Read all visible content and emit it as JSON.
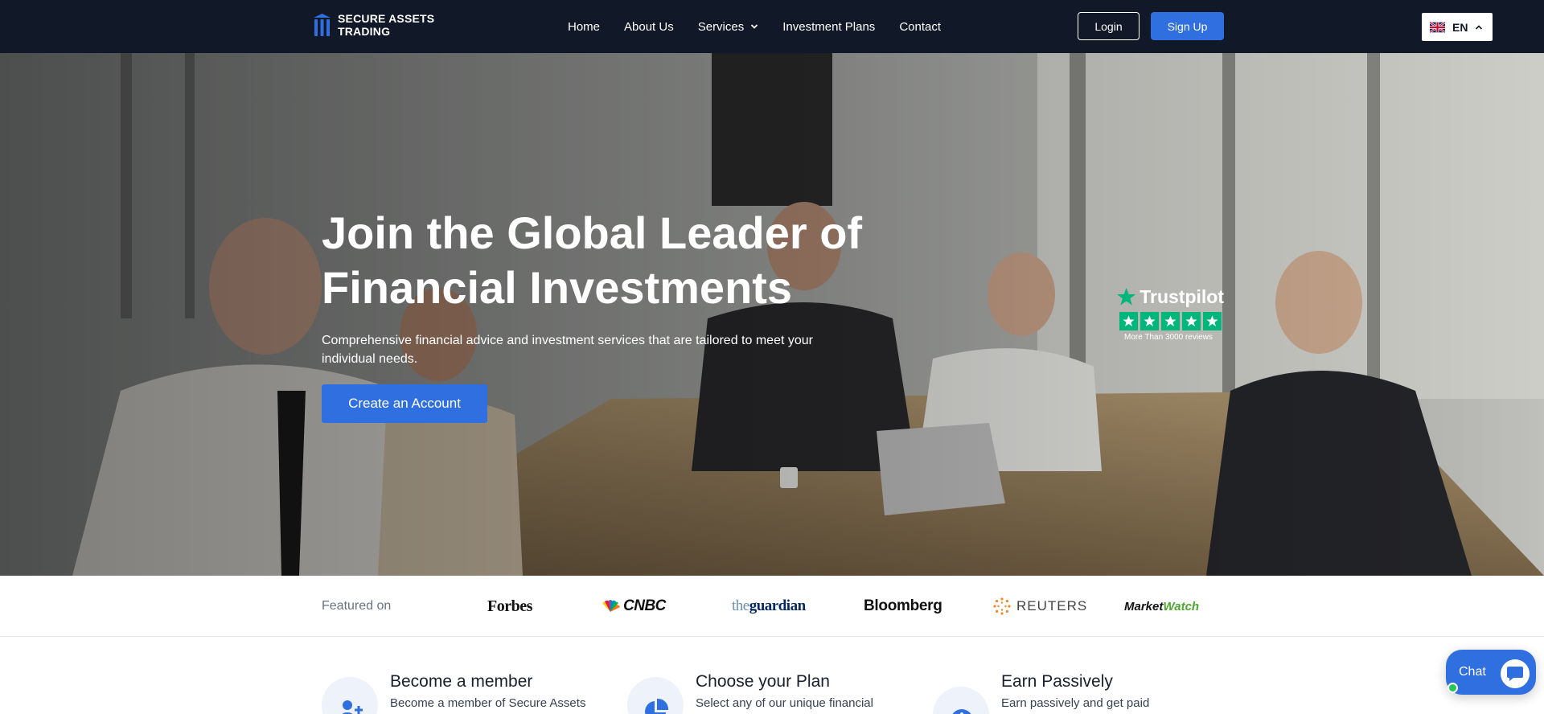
{
  "brand": {
    "name": "SECURE ASSETS TRADING"
  },
  "nav": {
    "home": "Home",
    "about": "About Us",
    "services": "Services",
    "plans": "Investment Plans",
    "contact": "Contact",
    "login": "Login",
    "signup": "Sign Up",
    "language": "EN"
  },
  "hero": {
    "title": "Join the Global Leader of Financial Investments",
    "subtitle": "Comprehensive financial advice and investment services that are tailored to meet your individual needs.",
    "cta": "Create an Account",
    "trustpilot": {
      "name": "Trustpilot",
      "rating_stars": 5,
      "reviews": "More Than 3000 reviews"
    }
  },
  "featured": {
    "label": "Featured on",
    "outlets": {
      "forbes": "Forbes",
      "cnbc": "CNBC",
      "guardian_prefix": "the",
      "guardian": "guardian",
      "bloomberg": "Bloomberg",
      "reuters": "REUTERS",
      "marketwatch_a": "Market",
      "marketwatch_b": "Watch"
    }
  },
  "steps": [
    {
      "title": "Become a member",
      "desc": "Become a member of Secure Assets"
    },
    {
      "title": "Choose your Plan",
      "desc": "Select any of our unique financial"
    },
    {
      "title": "Earn Passively",
      "desc": "Earn passively and get paid"
    }
  ],
  "chat": {
    "label": "Chat"
  },
  "colors": {
    "navbar": "#111827",
    "primary": "#2f6fe0",
    "trustpilot_green": "#00b67a"
  }
}
